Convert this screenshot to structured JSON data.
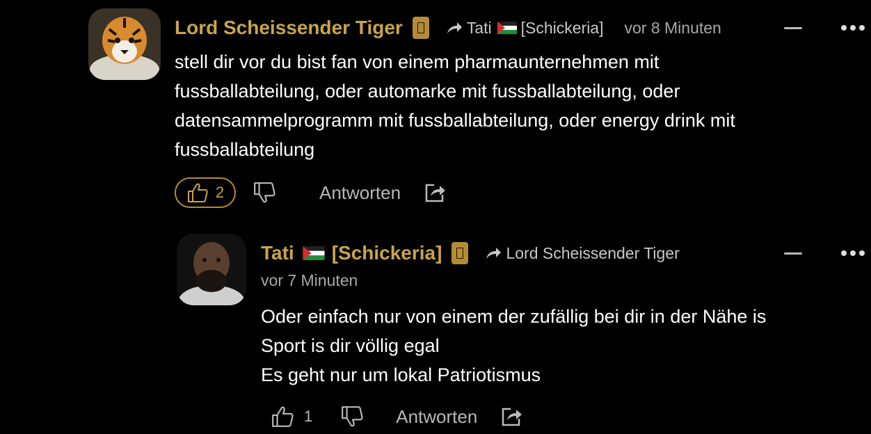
{
  "comments": [
    {
      "author": "Lord Scheissender Tiger",
      "reply_to": "Tati",
      "reply_to_tag": "[Schickeria]",
      "time": "vor 8 Minuten",
      "lines": [
        "stell dir vor du bist fan von einem pharmaunternehmen mit",
        "fussballabteilung, oder automarke mit fussballabteilung, oder",
        "datensammelprogramm mit fussballabteilung, oder energy drink mit",
        "fussballabteilung"
      ],
      "likes": "2",
      "reply_label": "Antworten"
    },
    {
      "author": "Tati",
      "author_tag": "[Schickeria]",
      "reply_to": "Lord Scheissender Tiger",
      "time": "vor 7 Minuten",
      "lines": [
        "Oder einfach nur von einem der zufällig bei dir in der Nähe is",
        "Sport is dir völlig egal",
        "Es geht nur um lokal Patriotismus"
      ],
      "likes": "1",
      "reply_label": "Antworten"
    }
  ],
  "colors": {
    "accent": "#c9a44a",
    "badge": "#b48c35",
    "background": "#000000"
  },
  "icons": [
    "tiger-avatar",
    "person-avatar",
    "badge-icon",
    "reply-arrow-icon",
    "palestine-flag-icon",
    "thumbs-up-icon",
    "thumbs-down-icon",
    "share-icon",
    "collapse-icon",
    "more-icon"
  ]
}
